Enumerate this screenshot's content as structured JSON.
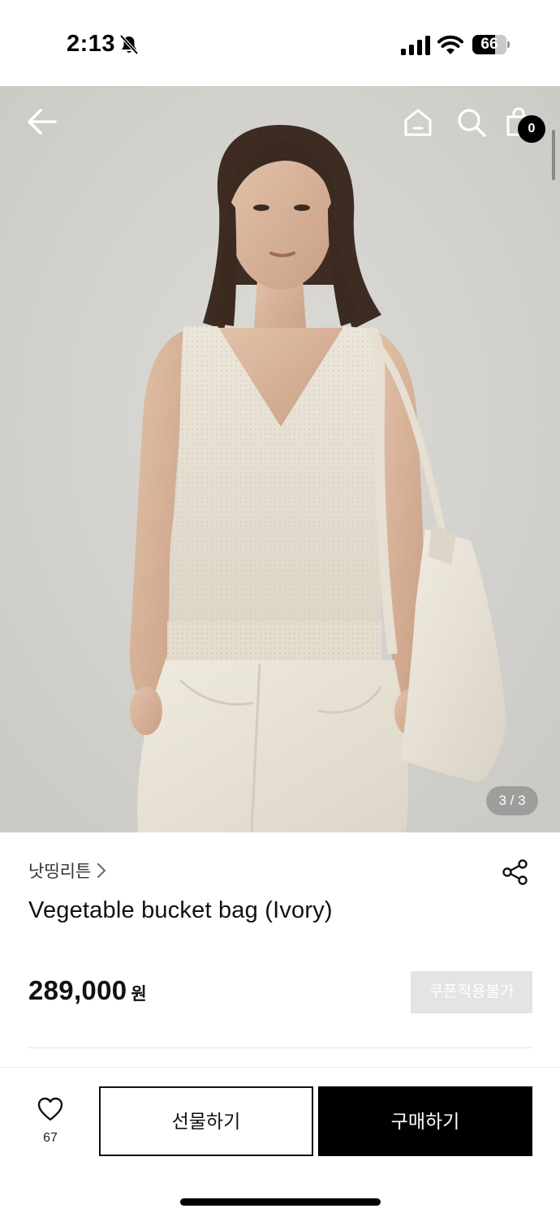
{
  "status_bar": {
    "time": "2:13",
    "battery_level": "66",
    "icons": [
      "bell-slash-icon",
      "cellular-signal-icon",
      "wifi-icon",
      "battery-icon"
    ]
  },
  "hero": {
    "image_description": "Model wearing an ivory knit sleeveless v-neck top and cream trousers, carrying an ivory bucket bag on the shoulder",
    "page_counter": "3 / 3",
    "current_slide": 3,
    "total_slides": 3
  },
  "nav": {
    "icons": [
      "back-arrow-icon",
      "home-icon",
      "search-icon",
      "cart-icon"
    ],
    "cart_count": "0"
  },
  "product": {
    "brand": "낫띵리튼",
    "title": "Vegetable bucket bag (Ivory)",
    "price": "289,000",
    "currency": "원",
    "coupon_label": "쿠폰적용불가"
  },
  "bottom_bar": {
    "wish_count": "67",
    "gift_label": "선물하기",
    "buy_label": "구매하기"
  },
  "colors": {
    "primary": "#000000",
    "background": "#ffffff",
    "muted_badge": "#e4e4e4",
    "hero_background": "#d5d4d0"
  }
}
